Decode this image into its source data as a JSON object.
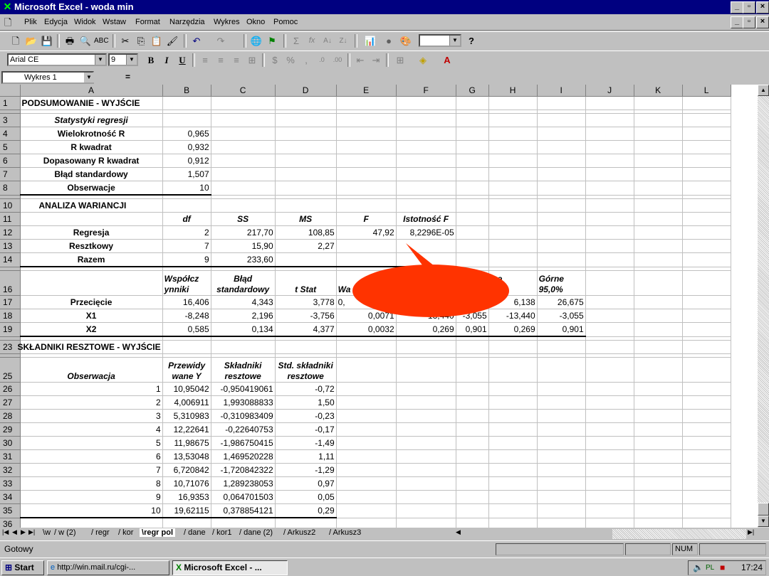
{
  "window": {
    "title": "Microsoft Excel - woda min"
  },
  "menu": [
    "Plik",
    "Edycja",
    "Widok",
    "Wstaw",
    "Format",
    "Narzędzia",
    "Wykres",
    "Okno",
    "Pomoc"
  ],
  "format_toolbar": {
    "font": "Arial CE",
    "size": "9",
    "bold": "B",
    "italic": "I",
    "underline": "U"
  },
  "name_box": "Wykres 1",
  "formula_eq": "=",
  "columns": [
    "A",
    "B",
    "C",
    "D",
    "E",
    "F",
    "G",
    "H",
    "I",
    "J",
    "K",
    "L"
  ],
  "summary": {
    "title": "PODSUMOWANIE - WYJŚCIE",
    "stats_header": "Statystyki regresji",
    "stats": [
      {
        "label": "Wielokrotność R",
        "value": "0,965"
      },
      {
        "label": "R kwadrat",
        "value": "0,932"
      },
      {
        "label": "Dopasowany R kwadrat",
        "value": "0,912"
      },
      {
        "label": "Błąd standardowy",
        "value": "1,507"
      },
      {
        "label": "Obserwacje",
        "value": "10"
      }
    ],
    "anova_title": "ANALIZA WARIANCJI",
    "anova_headers": [
      "df",
      "SS",
      "MS",
      "F",
      "Istotność F"
    ],
    "anova_rows": [
      {
        "label": "Regresja",
        "df": "2",
        "ss": "217,70",
        "ms": "108,85",
        "f": "47,92",
        "sig": "8,2296E-05"
      },
      {
        "label": "Resztkowy",
        "df": "7",
        "ss": "15,90",
        "ms": "2,27",
        "f": "",
        "sig": ""
      },
      {
        "label": "Razem",
        "df": "9",
        "ss": "233,60",
        "ms": "",
        "f": "",
        "sig": ""
      }
    ],
    "coef_headers": {
      "b1": "Współcz",
      "b2": "ynniki",
      "c1": "Błąd",
      "c2": "standardowy",
      "d": "t Stat",
      "e": "Wa",
      "h": "ise",
      "i1": "Górne",
      "i2": "95,0%"
    },
    "coef_rows": [
      {
        "label": "Przecięcie",
        "b": "16,406",
        "c": "4,343",
        "d": "3,778",
        "e": "0,",
        "f": "",
        "g": "",
        "h": "6,138",
        "i": "26,675"
      },
      {
        "label": "X1",
        "b": "-8,248",
        "c": "2,196",
        "d": "-3,756",
        "e": "0,0071",
        "f": "-13,440",
        "g": "-3,055",
        "h": "-13,440",
        "i": "-3,055"
      },
      {
        "label": "X2",
        "b": "0,585",
        "c": "0,134",
        "d": "4,377",
        "e": "0,0032",
        "f": "0,269",
        "g": "0,901",
        "h": "0,269",
        "i": "0,901"
      }
    ],
    "resid_title": "SKŁADNIKI RESZTOWE - WYJŚCIE",
    "resid_headers": {
      "a": "Obserwacja",
      "b1": "Przewidy",
      "b2": "wane Y",
      "c1": "Składniki",
      "c2": "resztowe",
      "d1": "Std. składniki",
      "d2": "resztowe"
    },
    "resid_rows": [
      [
        "1",
        "10,95042",
        "-0,950419061",
        "-0,72"
      ],
      [
        "2",
        "4,006911",
        "1,993088833",
        "1,50"
      ],
      [
        "3",
        "5,310983",
        "-0,310983409",
        "-0,23"
      ],
      [
        "4",
        "12,22641",
        "-0,22640753",
        "-0,17"
      ],
      [
        "5",
        "11,98675",
        "-1,986750415",
        "-1,49"
      ],
      [
        "6",
        "13,53048",
        "1,469520228",
        "1,11"
      ],
      [
        "7",
        "6,720842",
        "-1,720842322",
        "-1,29"
      ],
      [
        "8",
        "10,71076",
        "1,289238053",
        "0,97"
      ],
      [
        "9",
        "16,9353",
        "0,064701503",
        "0,05"
      ],
      [
        "10",
        "19,62115",
        "0,378854121",
        "0,29"
      ]
    ]
  },
  "callout_color": "#ff3300",
  "sheet_tabs": [
    "w",
    "w (2)",
    "regr",
    "kor",
    "regr pol",
    "dane",
    "kor1",
    "dane (2)",
    "Arkusz2",
    "Arkusz3"
  ],
  "active_tab": "regr pol",
  "status": {
    "text": "Gotowy",
    "num": "NUM"
  },
  "taskbar": {
    "start": "Start",
    "ie": "http://win.mail.ru/cgi-...",
    "excel": "Microsoft Excel - ...",
    "clock": "17:24"
  }
}
